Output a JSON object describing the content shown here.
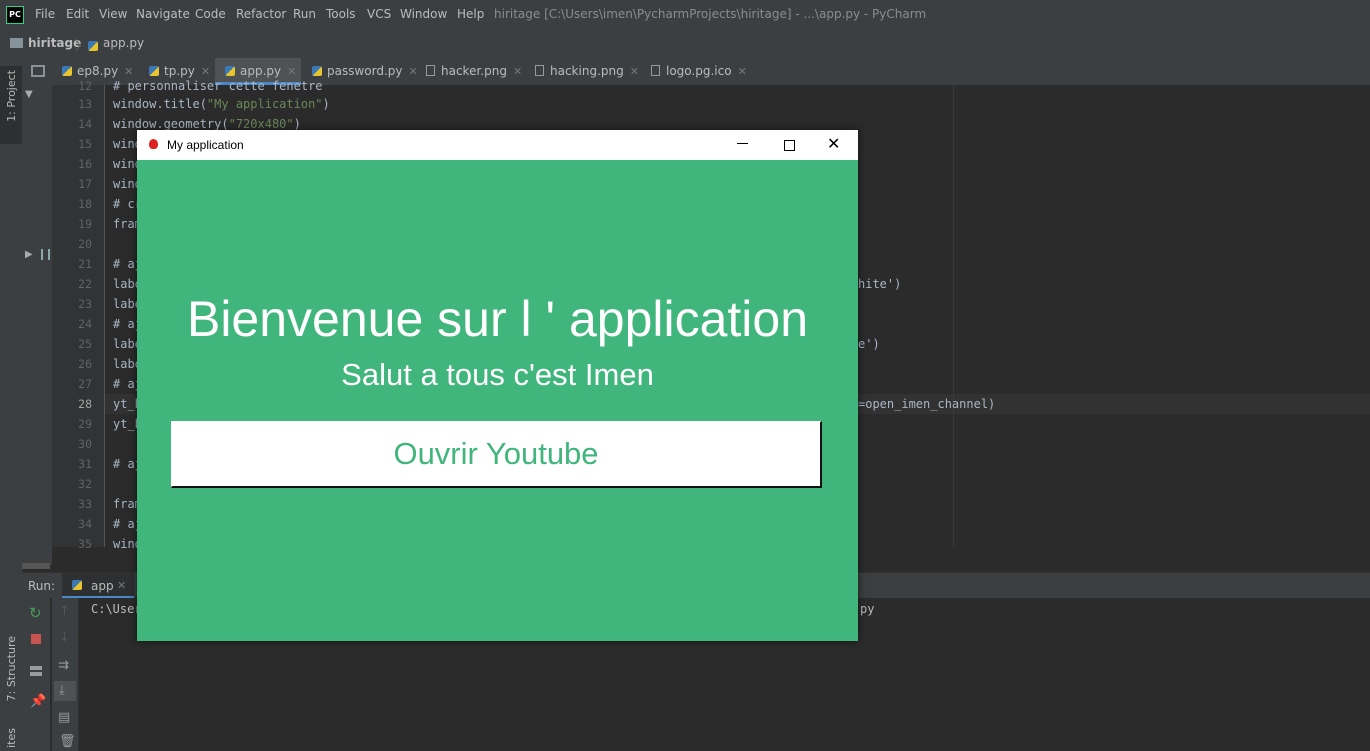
{
  "ide": {
    "logo": "PC",
    "menu": [
      "File",
      "Edit",
      "View",
      "Navigate",
      "Code",
      "Refactor",
      "Run",
      "Tools",
      "VCS",
      "Window",
      "Help"
    ],
    "window_title": "hiritage [C:\\Users\\imen\\PycharmProjects\\hiritage] - ...\\app.py - PyCharm",
    "breadcrumb": [
      "hiritage",
      "app.py"
    ],
    "left_tools": [
      "1: Project",
      "7: Structure",
      "ites"
    ],
    "tabs": [
      "ep8.py",
      "tp.py",
      "app.py",
      "password.py",
      "hacker.png",
      "hacking.png",
      "logo.pg.ico"
    ],
    "active_tab": "app.py"
  },
  "editor": {
    "line_numbers": [
      "12",
      "13",
      "14",
      "15",
      "16",
      "17",
      "18",
      "19",
      "20",
      "21",
      "22",
      "23",
      "24",
      "25",
      "26",
      "27",
      "28",
      "29",
      "30",
      "31",
      "32",
      "33",
      "34",
      "35"
    ],
    "lines": {
      "l12": "# personnaliser cette fenetre",
      "l13_a": "window.title(",
      "l13_b": "\"My application\"",
      "l13_c": ")",
      "l14_a": "window.geometry(",
      "l14_b": "\"720x480\"",
      "l14_c": ")",
      "l15": "wind",
      "l16": "wind",
      "l17": "wind",
      "l18": "# cr",
      "l19": "fram",
      "l21": "# aj",
      "l22": "labe",
      "l23": "labe",
      "l24": "# aj",
      "l25": "labe",
      "l26": "labe",
      "l27": "# aj",
      "l28": "yt_b",
      "l29": "yt_b",
      "l31": "# aj",
      "l33": "fram",
      "l34": "# aj",
      "l35": "wind"
    },
    "tails": {
      "t22": "hite')",
      "t25": "e')",
      "t28": "=open_imen_channel)"
    }
  },
  "run_panel": {
    "label": "Run:",
    "tab": "app",
    "console_start": "C:\\User",
    "console_end": "py"
  },
  "tk_window": {
    "title": "My application",
    "background": "#41b67c",
    "heading": "Bienvenue sur l ' application",
    "subheading": "Salut a tous c'est Imen",
    "button_label": "Ouvrir Youtube",
    "button_text_color": "#41b67c"
  }
}
